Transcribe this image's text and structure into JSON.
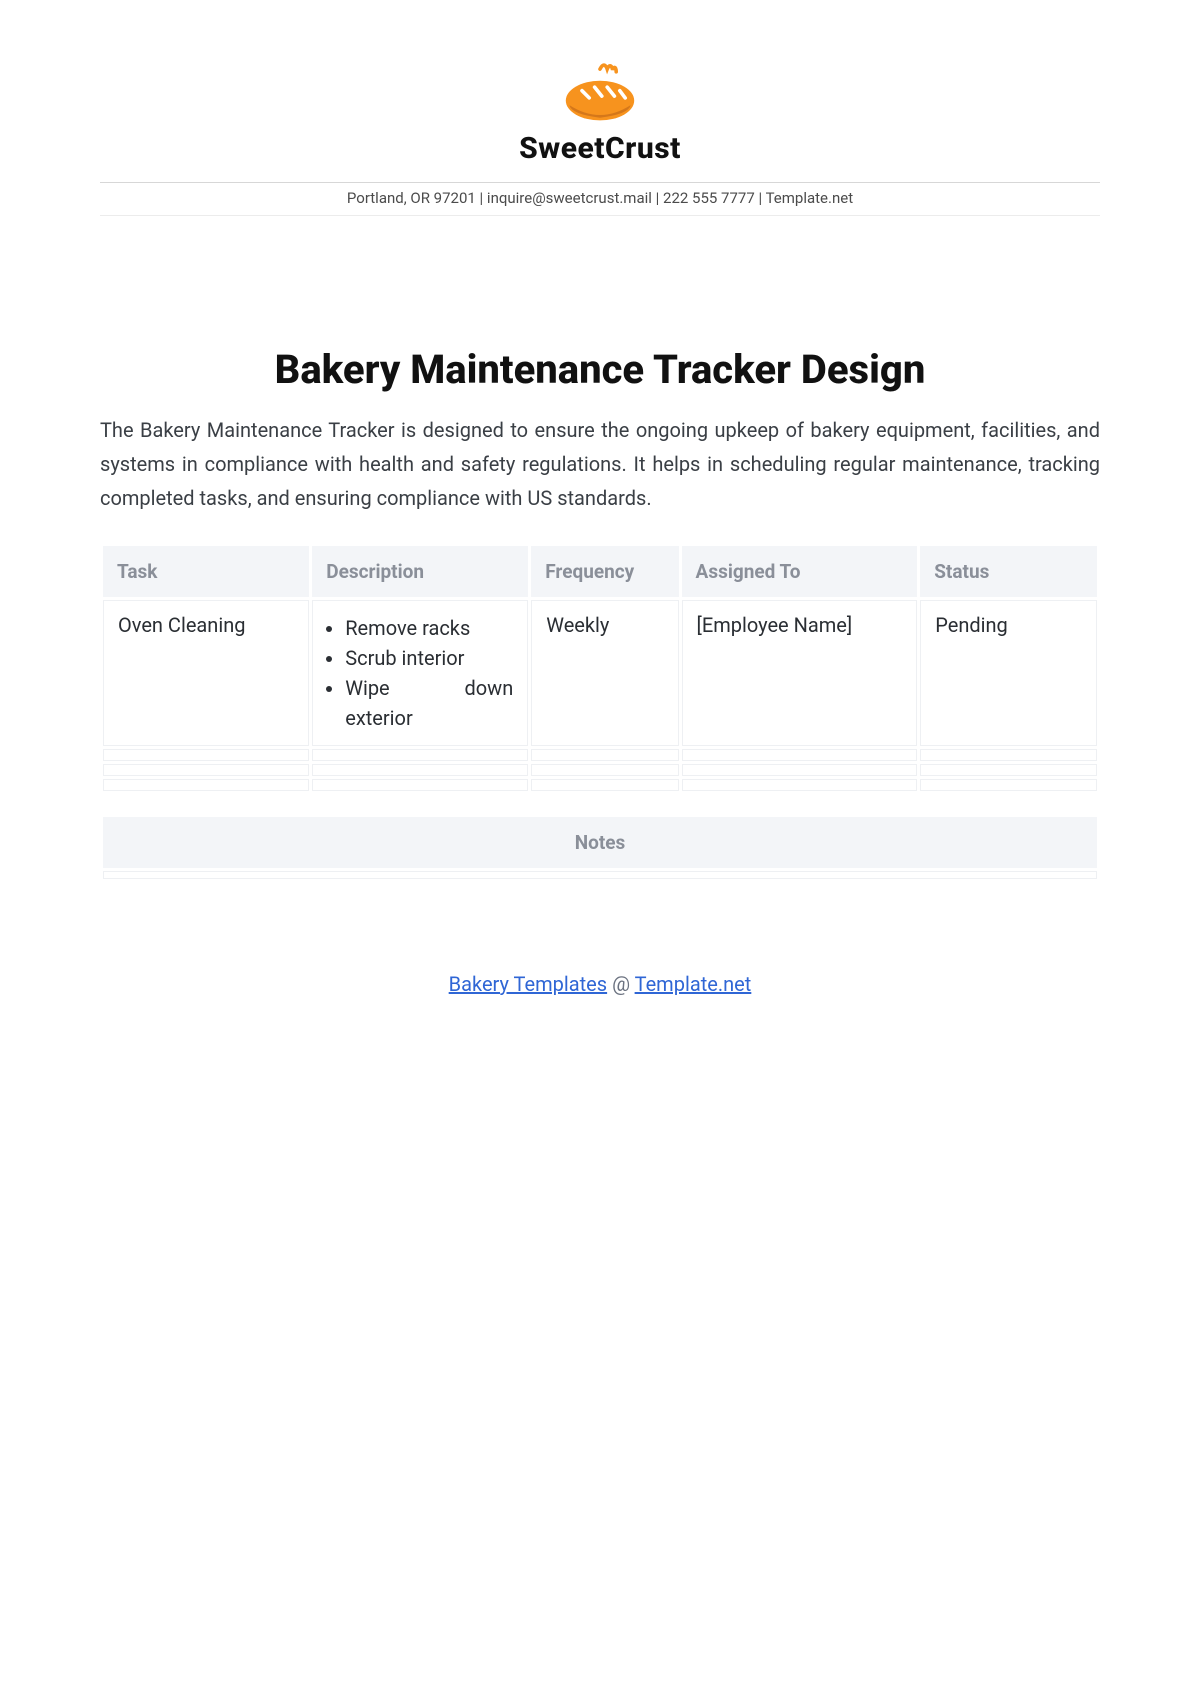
{
  "header": {
    "brand": "SweetCrust",
    "contact_line": "Portland, OR 97201 | inquire@sweetcrust.mail  | 222 555 7777 | Template.net"
  },
  "document": {
    "title": "Bakery Maintenance Tracker Design",
    "intro": "The Bakery Maintenance Tracker is designed to ensure the ongoing upkeep of bakery equipment, facilities, and systems in compliance with health and safety regulations. It helps in scheduling regular maintenance, tracking completed tasks, and ensuring compliance with US standards."
  },
  "table": {
    "headers": {
      "task": "Task",
      "description": "Description",
      "frequency": "Frequency",
      "assigned_to": "Assigned To",
      "status": "Status"
    },
    "rows": [
      {
        "task": "Oven Cleaning",
        "steps": [
          "Remove racks",
          "Scrub interior",
          "Wipe down exterior"
        ],
        "frequency": "Weekly",
        "assigned_to": "[Employee Name]",
        "status": "Pending"
      }
    ]
  },
  "notes": {
    "header": "Notes"
  },
  "footer": {
    "link1": "Bakery Templates",
    "at": " @ ",
    "link2": "Template.net"
  }
}
